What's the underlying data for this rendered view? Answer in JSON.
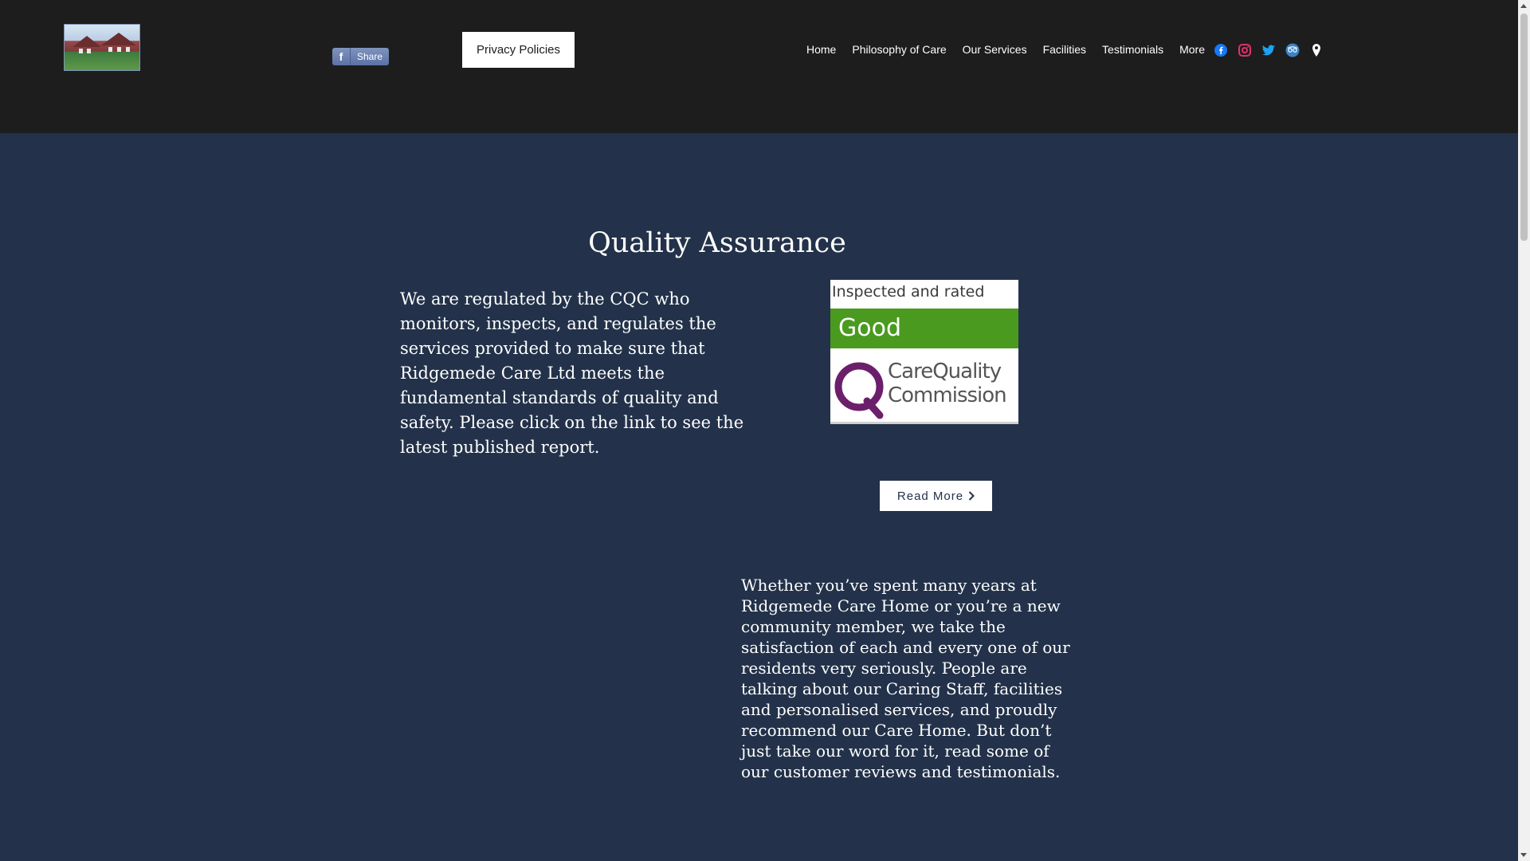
{
  "header": {
    "share_label": "Share",
    "privacy_label": "Privacy Policies",
    "nav": [
      {
        "label": "Home"
      },
      {
        "label": "Philosophy of Care"
      },
      {
        "label": "Our Services"
      },
      {
        "label": "Facilities"
      },
      {
        "label": "Testimonials"
      },
      {
        "label": "More"
      }
    ],
    "social_icons": [
      "facebook-icon",
      "instagram-icon",
      "twitter-icon",
      "tripadvisor-icon",
      "map-pin-icon"
    ]
  },
  "main": {
    "title": "Quality Assurance",
    "intro": " We are regulated by the CQC who monitors, inspects, and regulates the services provided to make sure that Ridgemede Care Ltd meets the fundamental standards of quality and safety. Please click on the link to see the latest published report.",
    "badge": {
      "top_text": "Inspected and rated",
      "rating": "Good",
      "org_line1": "CareQuality",
      "org_line2": "Commission"
    },
    "read_more_label": "Read More",
    "testimonial_intro": "Whether you’ve spent many years at Ridgemede Care Home or you’re a new community member, we take the satisfaction of each and every one of our residents very seriously. People are talking about our Caring Staff,  facilities and personalised services, and proudly recommend our Care Home. But don’t just take our word for it, read some of our customer reviews and testimonials."
  },
  "colors": {
    "header_bg": "#1d1d1d",
    "page_bg": "#23324a",
    "rating_green": "#4a9a1f",
    "cqc_purple": "#6b1f6b"
  }
}
